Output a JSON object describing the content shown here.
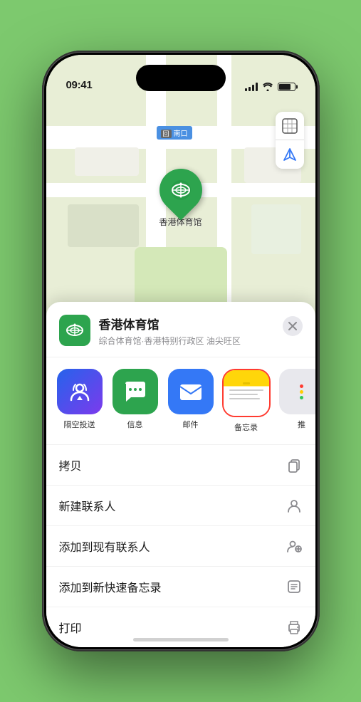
{
  "status_bar": {
    "time": "09:41",
    "location_arrow": "▲"
  },
  "map": {
    "road_label": "南口",
    "road_prefix": "回",
    "stadium_label": "香港体育馆"
  },
  "location_card": {
    "name": "香港体育馆",
    "subtitle": "综合体育馆·香港特别行政区 油尖旺区",
    "close_label": "✕"
  },
  "share_items": [
    {
      "id": "airdrop",
      "label": "隔空投送",
      "type": "airdrop"
    },
    {
      "id": "messages",
      "label": "信息",
      "type": "messages"
    },
    {
      "id": "mail",
      "label": "邮件",
      "type": "mail"
    },
    {
      "id": "notes",
      "label": "备忘录",
      "type": "notes",
      "selected": true
    },
    {
      "id": "more",
      "label": "推",
      "type": "more"
    }
  ],
  "actions": [
    {
      "id": "copy",
      "label": "拷贝",
      "icon": "copy"
    },
    {
      "id": "new-contact",
      "label": "新建联系人",
      "icon": "person"
    },
    {
      "id": "add-existing",
      "label": "添加到现有联系人",
      "icon": "person-add"
    },
    {
      "id": "add-notes",
      "label": "添加到新快速备忘录",
      "icon": "note"
    },
    {
      "id": "print",
      "label": "打印",
      "icon": "print"
    }
  ]
}
